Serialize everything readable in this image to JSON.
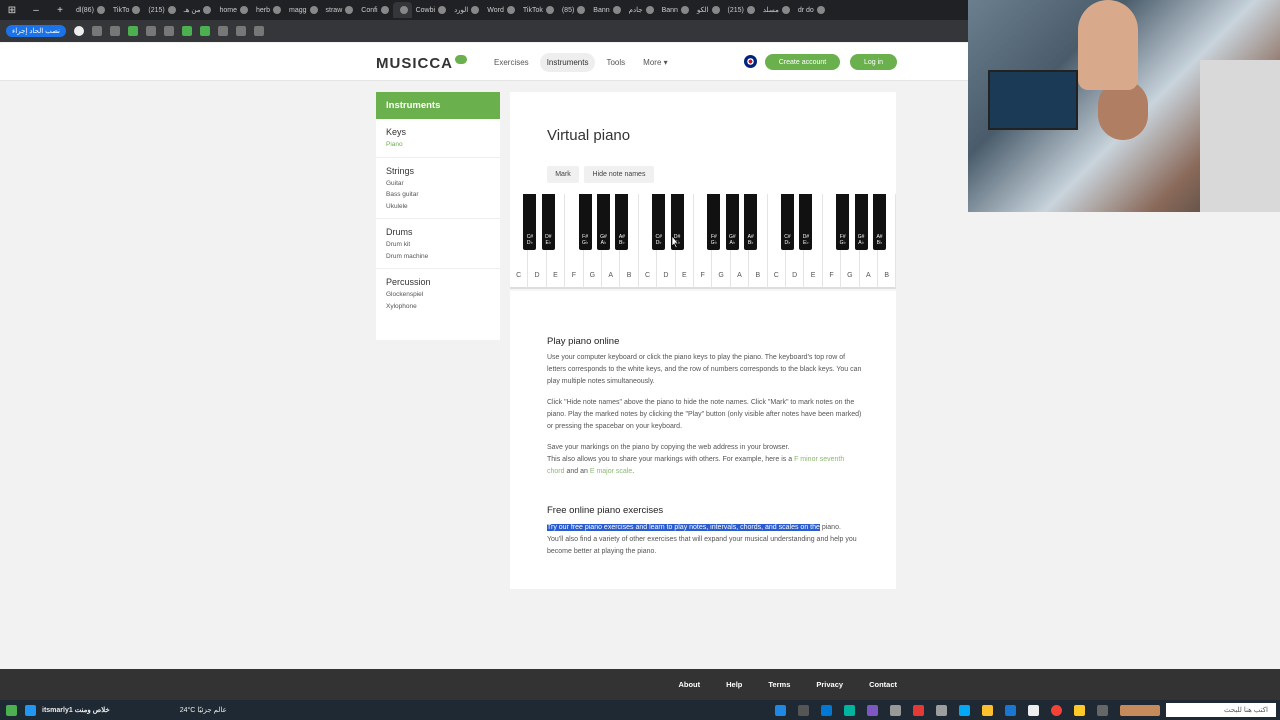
{
  "browser": {
    "tabs": [
      "dl(86)",
      "TikTo",
      "(215)",
      "من هـ",
      "home",
      "herb",
      "magg",
      "straw",
      "Confi",
      "",
      "Cowbi",
      "الورد",
      "Word",
      "TikTok",
      "(85)",
      "Bann",
      "جادم",
      "Bann",
      "الكو",
      "(215)",
      "مسلد",
      "dr do"
    ],
    "bookmark_button": "نصب الحاد إجراء"
  },
  "header": {
    "logo": "MUSICCA",
    "nav": [
      "Exercises",
      "Instruments",
      "Tools",
      "More ▾"
    ],
    "create_account": "Create account",
    "login": "Log in"
  },
  "sidebar": {
    "title": "Instruments",
    "groups": [
      {
        "title": "Keys",
        "items": [
          "Piano"
        ]
      },
      {
        "title": "Strings",
        "items": [
          "Guitar",
          "Bass guitar",
          "Ukulele"
        ]
      },
      {
        "title": "Drums",
        "items": [
          "Drum kit",
          "Drum machine"
        ]
      },
      {
        "title": "Percussion",
        "items": [
          "Glockenspiel",
          "Xylophone"
        ]
      }
    ]
  },
  "main": {
    "title": "Virtual piano",
    "mark_button": "Mark",
    "hide_button": "Hide note names",
    "white_keys": [
      "C",
      "D",
      "E",
      "F",
      "G",
      "A",
      "B",
      "C",
      "D",
      "E",
      "F",
      "G",
      "A",
      "B",
      "C",
      "D",
      "E",
      "F",
      "G",
      "A",
      "B"
    ],
    "black_keys": [
      "C#\nD♭",
      "D#\nE♭",
      "F#\nG♭",
      "G#\nA♭",
      "A#\nB♭",
      "C#\nD♭",
      "D#\nE♭",
      "F#\nG♭",
      "G#\nA♭",
      "A#\nB♭",
      "C#\nD♭",
      "D#\nE♭",
      "F#\nG♭",
      "G#\nA♭",
      "A#\nB♭"
    ],
    "section1_title": "Play piano online",
    "p1": "Use your computer keyboard or click the piano keys to play the piano. The keyboard's top row of letters corresponds to the white keys, and the row of numbers corresponds to the black keys. You can play multiple notes simultaneously.",
    "p2": "Click \"Hide note names\" above the piano to hide the note names. Click \"Mark\" to mark notes on the piano. Play the marked notes by clicking the \"Play\" button (only visible after notes have been marked) or pressing the spacebar on your keyboard.",
    "p3a": "Save your markings on the piano by copying the web address in your browser.",
    "p3b": "This also allows you to share your markings with others. For example, here is a ",
    "p3_link1": "F minor seventh chord",
    "p3_mid": " and an ",
    "p3_link2": "E major scale",
    "p3_end": ".",
    "section2_title": "Free online piano exercises",
    "p4_highlight": "Try our free piano exercises and learn to play notes, intervals, chords, and scales on the",
    "p4_rest": " piano. You'll also find a variety of other exercises that will expand your musical understanding and help you become better at playing the piano."
  },
  "footer": {
    "links": [
      "About",
      "Help",
      "Terms",
      "Privacy",
      "Contact"
    ]
  },
  "taskbar": {
    "left_text": "itsmarly1 خلاص ومنت",
    "weather": "24°C عالم جزئيًا",
    "search": "اكتب هنا للبحث"
  }
}
